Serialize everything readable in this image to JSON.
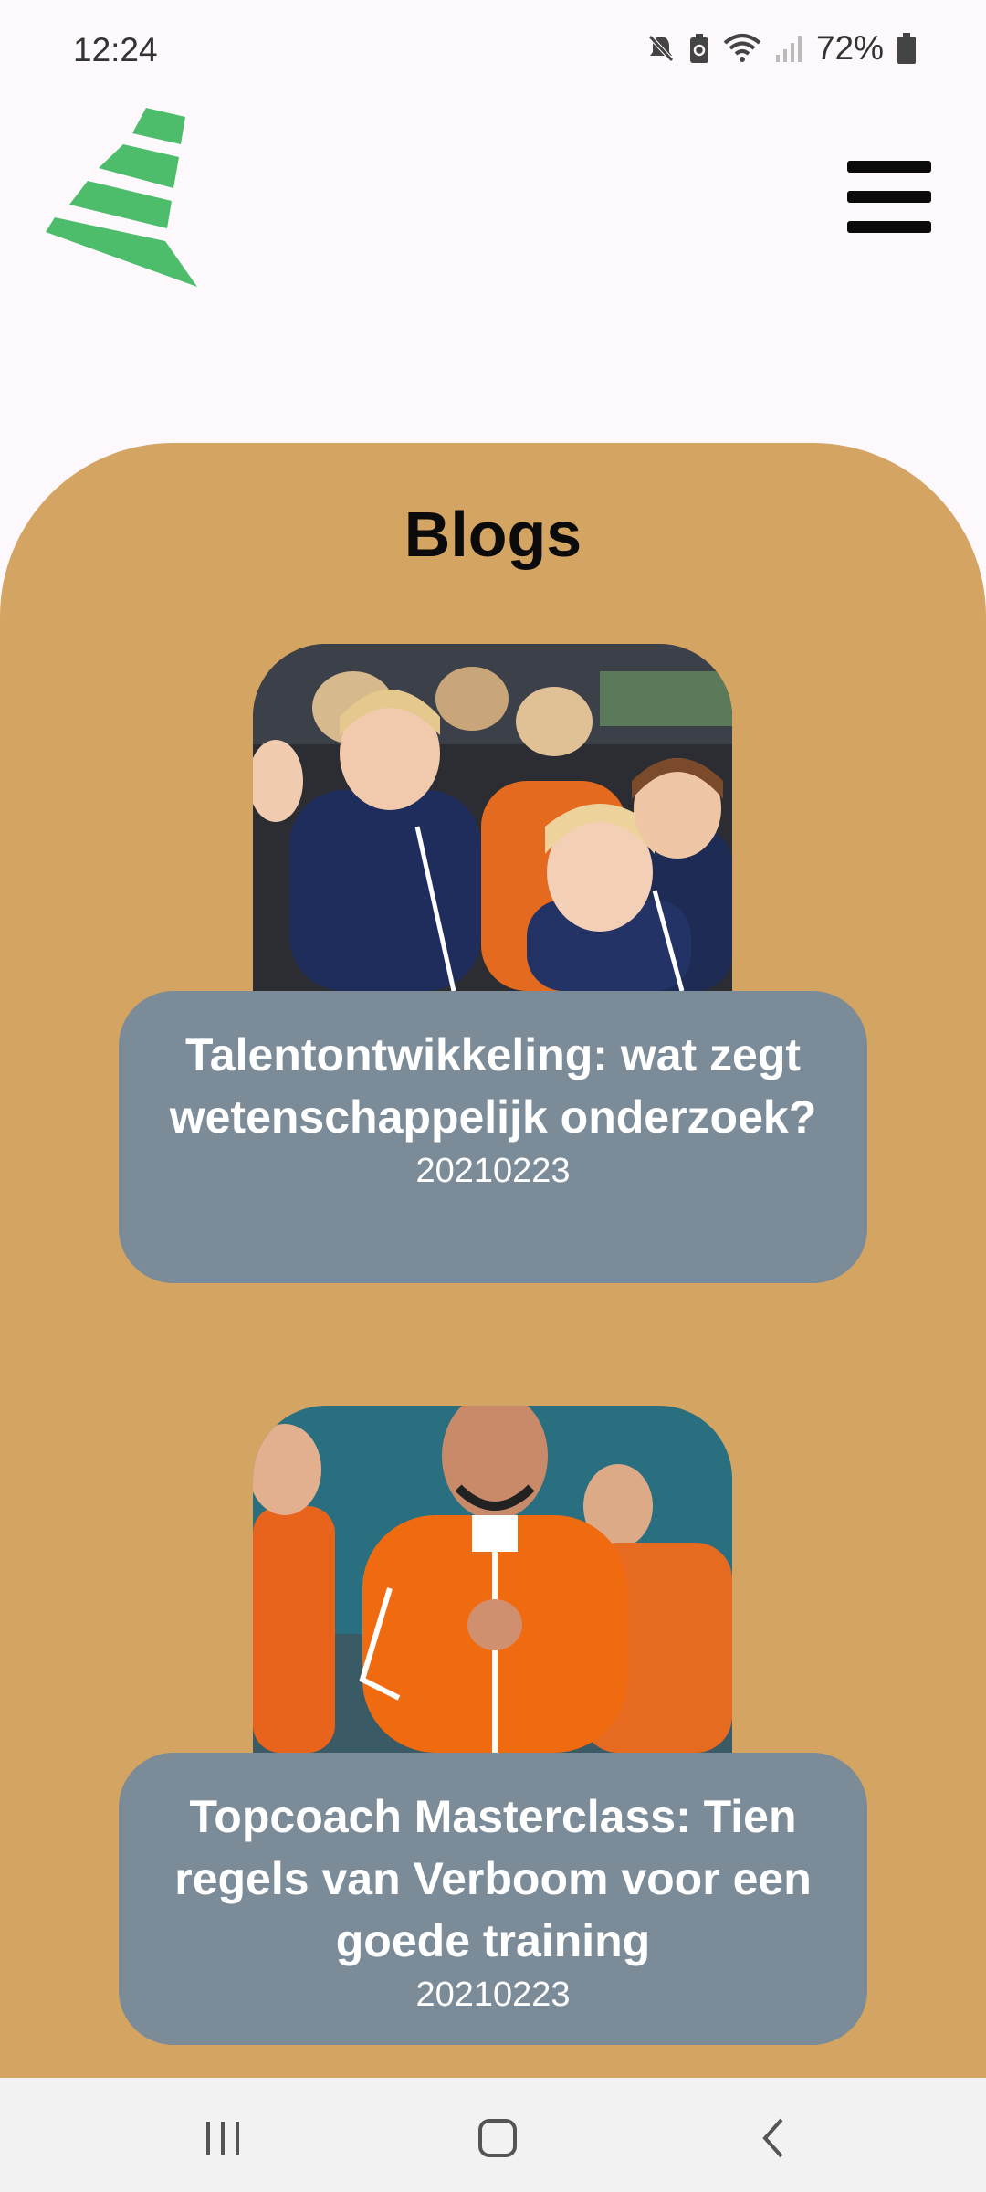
{
  "status_bar": {
    "time": "12:24",
    "battery_percent": "72%",
    "icons": [
      "mute-icon",
      "battery-saver-icon",
      "wifi-icon",
      "signal-icon",
      "battery-icon"
    ]
  },
  "header": {
    "logo_icon": "cone-logo-icon",
    "menu_icon": "hamburger-menu-icon"
  },
  "colors": {
    "background": "#fdf8fc",
    "content_panel": "#d4a462",
    "card_panel": "#7b8b98",
    "logo_green": "#4dbd6c"
  },
  "page": {
    "title": "Blogs"
  },
  "blogs": [
    {
      "title": "Talentontwikkeling: wat zegt wetenschappelijk onderzoek?",
      "date": "20210223"
    },
    {
      "title": "Topcoach Masterclass: Tien regels van Verboom voor een goede training",
      "date": "20210223"
    }
  ],
  "nav_bar": {
    "icons": [
      "recent-apps-icon",
      "home-icon",
      "back-icon"
    ]
  }
}
